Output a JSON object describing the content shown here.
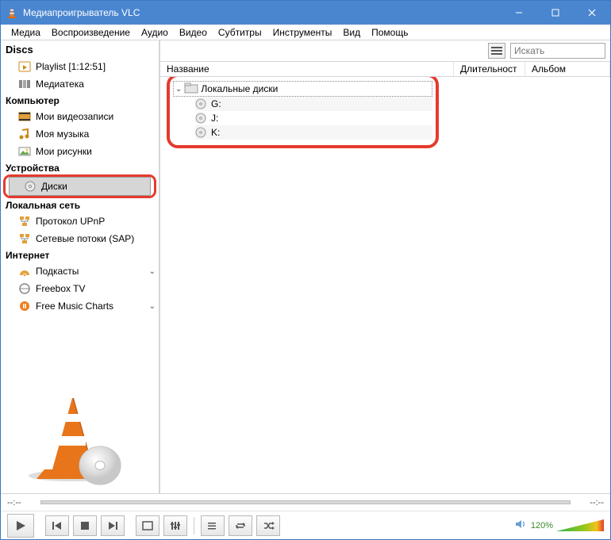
{
  "title": "Медиапроигрыватель VLC",
  "menu": {
    "media": "Медиа",
    "playback": "Воспроизведение",
    "audio": "Аудио",
    "video": "Видео",
    "subs": "Субтитры",
    "tools": "Инструменты",
    "view": "Вид",
    "help": "Помощь"
  },
  "sidebar": {
    "heading": "Discs",
    "playlist": "Playlist [1:12:51]",
    "library": "Медиатека",
    "sec_computer": "Компьютер",
    "my_videos": "Мои видеозаписи",
    "my_music": "Моя музыка",
    "my_pictures": "Мои рисунки",
    "sec_devices": "Устройства",
    "discs": "Диски",
    "sec_lan": "Локальная сеть",
    "upnp": "Протокол UPnP",
    "sap": "Сетевые потоки (SAP)",
    "sec_internet": "Интернет",
    "podcasts": "Подкасты",
    "freebox": "Freebox TV",
    "fmc": "Free Music Charts"
  },
  "columns": {
    "name": "Название",
    "duration": "Длительност",
    "album": "Альбом"
  },
  "search_placeholder": "Искать",
  "tree": {
    "root": "Локальные диски",
    "items": [
      "G:",
      "J:",
      "K:"
    ]
  },
  "seek": {
    "cur": "--:--",
    "total": "--:--"
  },
  "volume": {
    "percent": "120%"
  }
}
